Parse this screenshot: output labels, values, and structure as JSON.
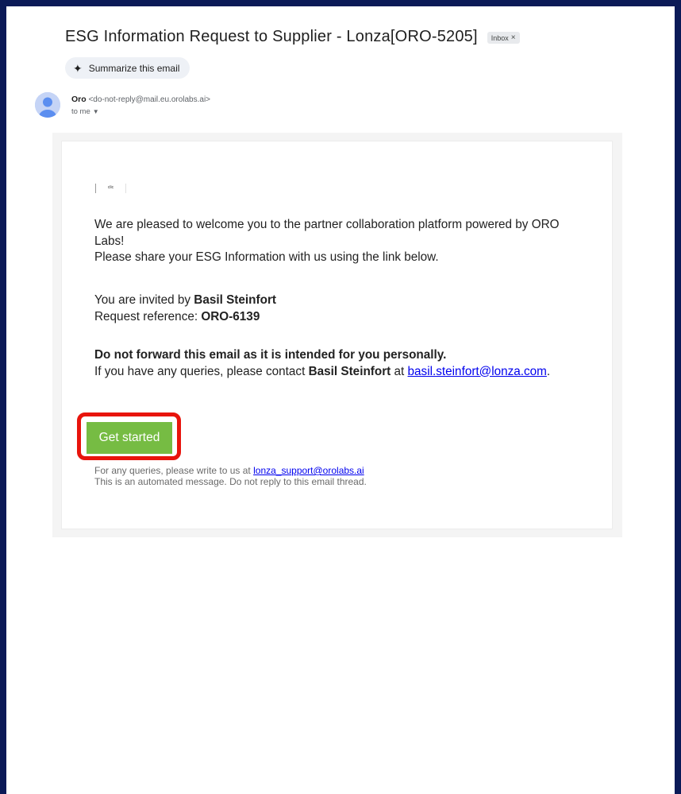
{
  "email": {
    "subject": "ESG Information Request to Supplier - Lonza[ORO-5205]",
    "label_chip": "Inbox",
    "label_chip_close": "×",
    "summarize_label": "Summarize this email",
    "sender_name": "Oro",
    "sender_email": "<do-not-reply@mail.eu.orolabs.ai>",
    "recipient": "to me",
    "logo_alt": "clic"
  },
  "content": {
    "welcome_line": "We are pleased to welcome you to the partner collaboration platform powered by ORO Labs!",
    "share_line": "Please share your ESG Information with us using the link below.",
    "invited_prefix": "You are invited by ",
    "invited_name": "Basil Steinfort",
    "reference_prefix": "Request reference: ",
    "reference_value": "ORO-6139",
    "warning": "Do not forward this email as it is intended for you personally.",
    "contact_prefix": "If you have any queries, please contact ",
    "contact_name": "Basil Steinfort",
    "contact_mid": " at ",
    "contact_email": "basil.steinfort@lonza.com",
    "contact_suffix": ".",
    "cta_label": "Get started",
    "footer_prefix": "For any queries, please write to us at ",
    "footer_email": "lonza_support@orolabs.ai",
    "footer_note": "This is an automated message. Do not reply to this email thread."
  },
  "colors": {
    "frame": "#0b1a57",
    "cta": "#76bc43",
    "highlight": "#e8140c",
    "link": "#0000ee"
  }
}
